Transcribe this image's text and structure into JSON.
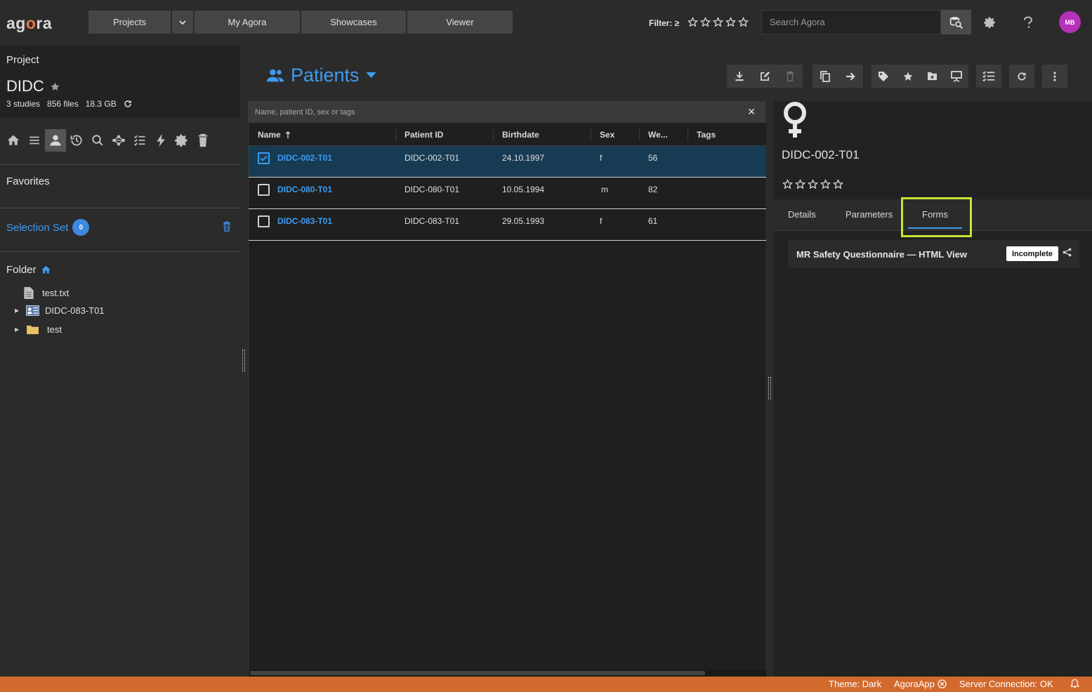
{
  "app": {
    "logo_prefix": "ag",
    "logo_o": "o",
    "logo_suffix": "ra"
  },
  "topnav": {
    "projects": "Projects",
    "my_agora": "My Agora",
    "showcases": "Showcases",
    "viewer": "Viewer",
    "filter_label": "Filter: ≥",
    "search_placeholder": "Search Agora",
    "avatar_initials": "MB"
  },
  "project": {
    "label": "Project",
    "name": "DIDC",
    "studies": "3 studies",
    "files": "856 files",
    "size": "18.3 GB"
  },
  "sidebar": {
    "favorites": "Favorites",
    "selection_set": "Selection Set",
    "selection_count": "0",
    "folder": "Folder",
    "tree": [
      {
        "label": "test.txt",
        "type": "file-icon"
      },
      {
        "label": "DIDC-083-T01",
        "type": "patient-icon"
      },
      {
        "label": "test",
        "type": "folder-icon"
      }
    ]
  },
  "main": {
    "title": "Patients",
    "filter_placeholder": "Name, patient ID, sex or tags",
    "columns": [
      "Name",
      "Patient ID",
      "Birthdate",
      "Sex",
      "We...",
      "Tags"
    ],
    "rows": [
      {
        "name": "DIDC-002-T01",
        "pid": "DIDC-002-T01",
        "birthdate": "24.10.1997",
        "sex": "f",
        "weight": "56",
        "tags": "",
        "selected": true
      },
      {
        "name": "DIDC-080-T01",
        "pid": "DIDC-080-T01",
        "birthdate": "10.05.1994",
        "sex": "m",
        "weight": "82",
        "tags": "",
        "selected": false
      },
      {
        "name": "DIDC-083-T01",
        "pid": "DIDC-083-T01",
        "birthdate": "29.05.1993",
        "sex": "f",
        "weight": "61",
        "tags": "",
        "selected": false
      }
    ]
  },
  "detail": {
    "patient_id": "DIDC-002-T01",
    "tabs": [
      "Details",
      "Parameters",
      "Forms"
    ],
    "active_tab": "Forms",
    "form_name": "MR Safety Questionnaire — HTML View",
    "form_status": "Incomplete"
  },
  "footer": {
    "theme": "Theme: Dark",
    "app": "AgoraApp",
    "server": "Server Connection: OK"
  },
  "colors": {
    "accent": "#3d9bf0",
    "footer": "#d26a2e",
    "highlight": "#c3e635",
    "avatar": "#b531b8"
  }
}
